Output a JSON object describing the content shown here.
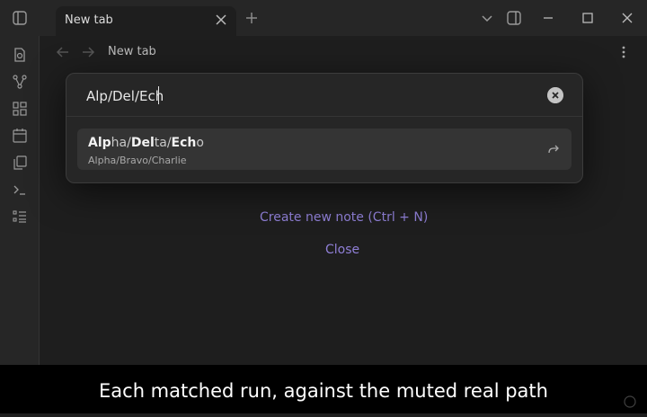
{
  "tab": {
    "title": "New tab"
  },
  "navbar": {
    "title": "New tab"
  },
  "search": {
    "value": "Alp/Del/Ech"
  },
  "suggestion": {
    "title_segments": [
      {
        "text": "Alp",
        "matched": true
      },
      {
        "text": "ha/",
        "matched": false
      },
      {
        "text": "Del",
        "matched": true
      },
      {
        "text": "ta/",
        "matched": false
      },
      {
        "text": "Ech",
        "matched": true
      },
      {
        "text": "o",
        "matched": false
      }
    ],
    "path": "Alpha/Bravo/Charlie"
  },
  "empty_state": {
    "create_label": "Create new note (Ctrl + N)",
    "close_label": "Close"
  },
  "caption": "Each matched run, against the muted real path",
  "colors": {
    "accent": "#8f7fd6",
    "background": "#1e1e1e",
    "panel": "#262626"
  }
}
